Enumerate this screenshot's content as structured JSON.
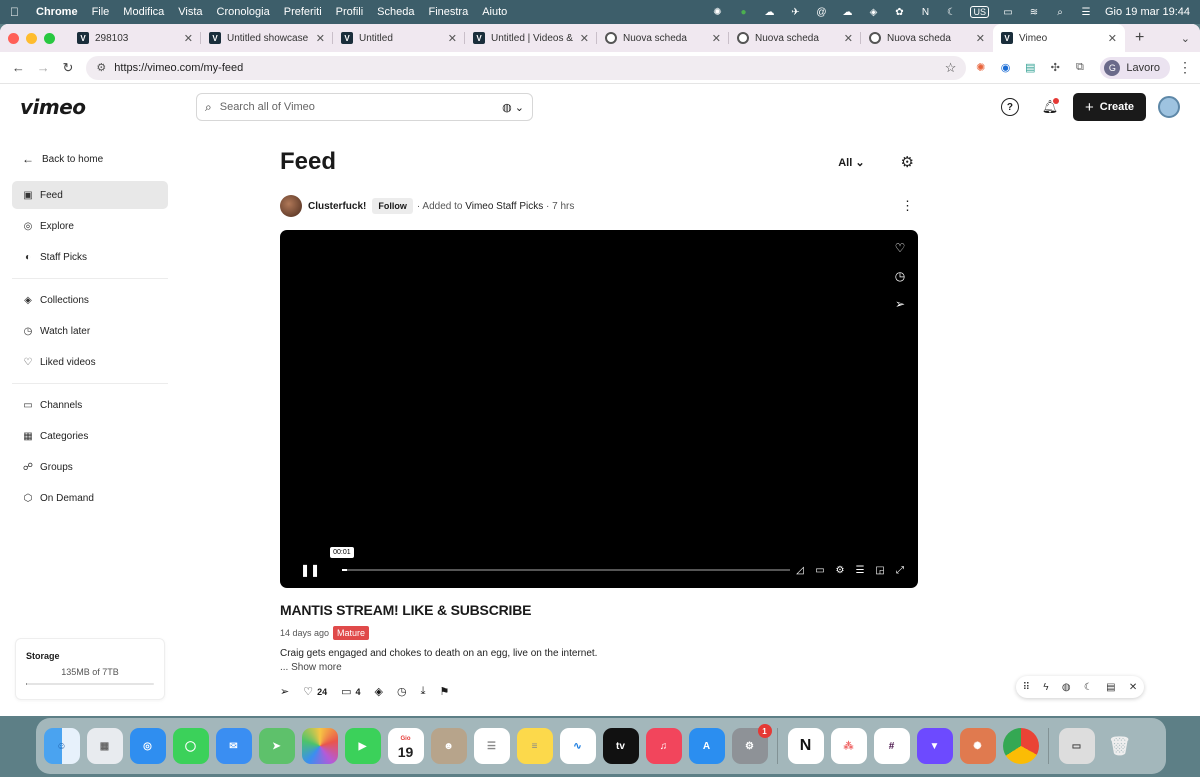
{
  "menubar": {
    "app": "Chrome",
    "items": [
      "File",
      "Modifica",
      "Vista",
      "Cronologia",
      "Preferiti",
      "Profili",
      "Scheda",
      "Finestra",
      "Aiuto"
    ],
    "input_source": "US",
    "datetime": "Gio 19 mar  19:44"
  },
  "tabs": [
    {
      "label": "298103",
      "favicon": "vimeo-icon"
    },
    {
      "label": "Untitled showcase o",
      "favicon": "vimeo-icon"
    },
    {
      "label": "Untitled",
      "favicon": "vimeo-icon"
    },
    {
      "label": "Untitled | Videos & M",
      "favicon": "vimeo-icon"
    },
    {
      "label": "Nuova scheda",
      "favicon": "chrome-icon"
    },
    {
      "label": "Nuova scheda",
      "favicon": "chrome-icon"
    },
    {
      "label": "Nuova scheda",
      "favicon": "chrome-icon"
    },
    {
      "label": "Vimeo",
      "favicon": "vimeo-icon",
      "active": true
    }
  ],
  "toolbar": {
    "url": "https://vimeo.com/my-feed",
    "profile_initial": "G",
    "profile_name": "Lavoro"
  },
  "header": {
    "logo": "vimeo",
    "search_placeholder": "Search all of Vimeo",
    "help": "?",
    "create_label": "Create"
  },
  "sidebar": {
    "back_label": "Back to home",
    "groups": [
      [
        {
          "label": "Feed",
          "icon": "feed-icon",
          "active": true
        },
        {
          "label": "Explore",
          "icon": "compass-icon"
        },
        {
          "label": "Staff Picks",
          "icon": "staff-picks-icon"
        }
      ],
      [
        {
          "label": "Collections",
          "icon": "layers-icon"
        },
        {
          "label": "Watch later",
          "icon": "clock-icon"
        },
        {
          "label": "Liked videos",
          "icon": "heart-icon"
        }
      ],
      [
        {
          "label": "Channels",
          "icon": "tv-icon"
        },
        {
          "label": "Categories",
          "icon": "grid-icon"
        },
        {
          "label": "Groups",
          "icon": "people-icon"
        },
        {
          "label": "On Demand",
          "icon": "on-demand-icon"
        }
      ]
    ],
    "storage": {
      "title": "Storage",
      "value": "135MB of 7TB",
      "used_fraction": 0.0
    }
  },
  "feed": {
    "title": "Feed",
    "filter": "All",
    "post": {
      "author": "Clusterfuck!",
      "follow_label": "Follow",
      "meta_prefix": "· Added to",
      "channel": "Vimeo Staff Picks",
      "age": "· 7 hrs",
      "timestamp_tooltip": "00:01",
      "progress_fraction": 0.01,
      "video_title": "MANTIS STREAM! LIKE & SUBSCRIBE",
      "posted": "14 days ago",
      "badge": "Mature",
      "description": "Craig gets engaged and chokes to death on an egg, live on the internet.",
      "show_more": "... Show more",
      "likes": "24",
      "comments": "4"
    }
  },
  "dock": {
    "calendar_day": "19",
    "calendar_month": "Gio",
    "settings_badge": "1",
    "tv_label": "tv"
  },
  "colors": {
    "accent_dark": "#1a1a1a",
    "mature_badge": "#e04a4a",
    "notification_dot": "#e53935"
  }
}
